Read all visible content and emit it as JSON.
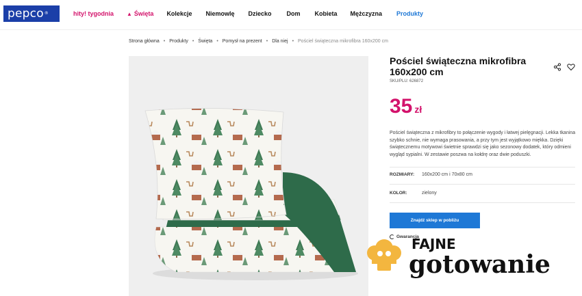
{
  "header": {
    "logo_text": "pepco",
    "nav": [
      {
        "label": "hity! tygodnia",
        "color": "#d3126b"
      },
      {
        "label": "Święta",
        "icon": "tree-icon",
        "color": "#d3126b"
      },
      {
        "label": "Kolekcje"
      },
      {
        "label": "Niemowlę"
      },
      {
        "label": "Dziecko"
      },
      {
        "label": "Dom"
      },
      {
        "label": "Kobieta"
      },
      {
        "label": "Mężczyzna"
      },
      {
        "label": "Produkty",
        "color": "#1e78d6"
      }
    ]
  },
  "breadcrumb": [
    "Strona główna",
    "Produkty",
    "Święta",
    "Pomysł na prezent",
    "Dla niej",
    "Pościel świąteczna mikrofibra 160x200 cm"
  ],
  "product": {
    "title": "Pościel świąteczna mikrofibra 160x200 cm",
    "sku": "SKU/PLU: 626872",
    "price_value": "35",
    "price_currency": "zł",
    "description": "Pościel świąteczna z mikrofibry to połączenie wygody i łatwej pielęgnacji. Lekka tkanina szybko schnie, nie wymaga prasowania, a przy tym jest wyjątkowo miękka. Dzięki świątecznemu motywowi świetnie sprawdzi się jako sezonowy dodatek, który odmieni wygląd sypialni. W zestawie poszwa na kołdrę oraz dwie poduszki.",
    "specs": [
      {
        "label": "ROZMIARY:",
        "value": "160x200 cm i 70x80 cm"
      },
      {
        "label": "KOLOR:",
        "value": "zielony"
      }
    ],
    "find_store_label": "Znajdź sklep w pobliżu",
    "guarantee_label": "Gwarancja"
  },
  "watermark": {
    "line1": "FAJNE",
    "line2": "gotowanie"
  },
  "colors": {
    "brand": "#1b3fa8",
    "accent": "#d3126b",
    "button": "#1e78d6",
    "bedding_green": "#2e6b4a"
  }
}
